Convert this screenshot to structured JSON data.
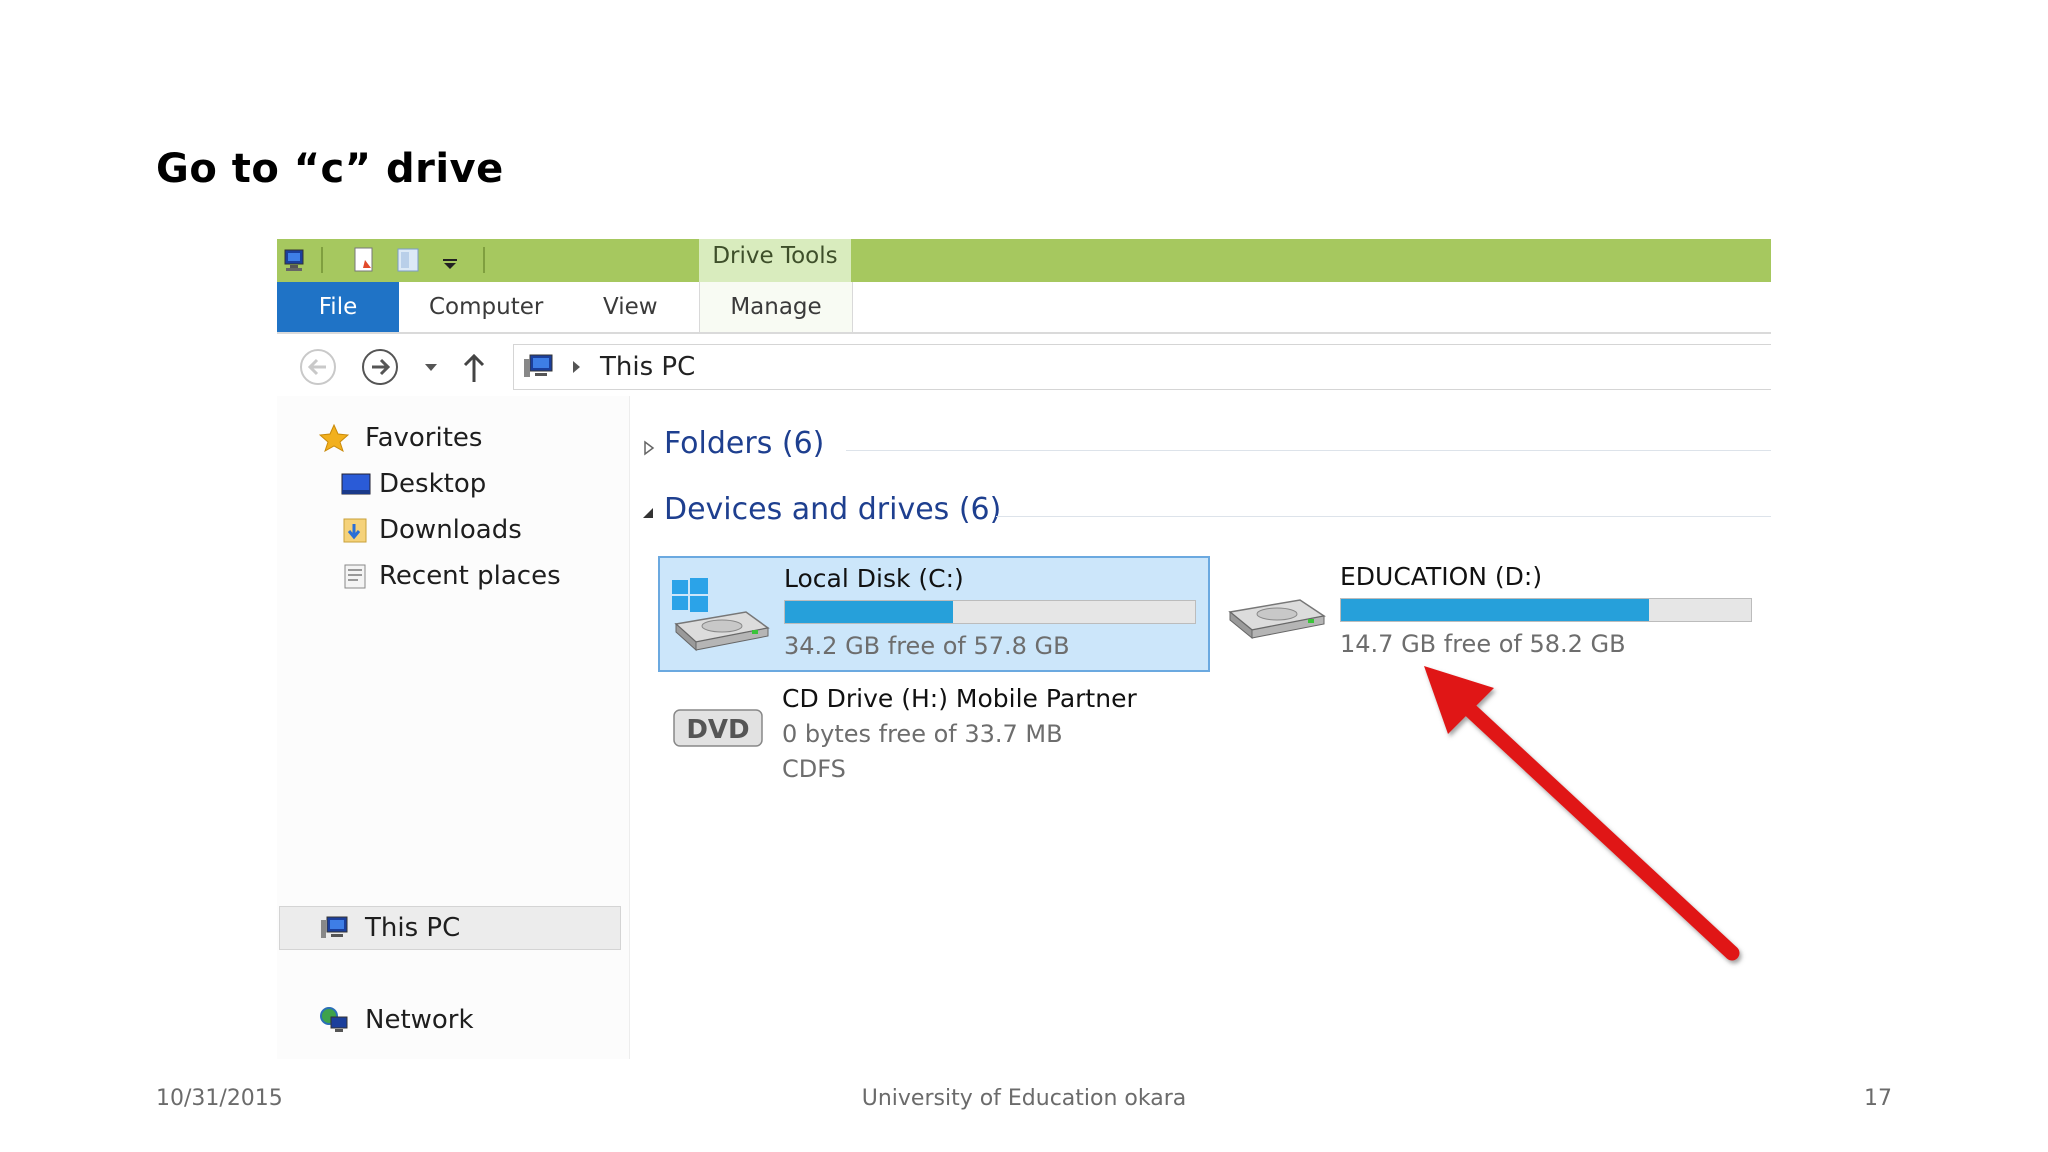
{
  "slide": {
    "title": "Go to “c” drive",
    "footer_date": "10/31/2015",
    "footer_center": "University of Education okara",
    "page_number": "17"
  },
  "ribbon": {
    "context_label": "Drive Tools",
    "tabs": [
      "File",
      "Computer",
      "View",
      "Manage"
    ]
  },
  "address": {
    "location": "This PC"
  },
  "nav": {
    "favorites": "Favorites",
    "desktop": "Desktop",
    "downloads": "Downloads",
    "recent": "Recent places",
    "thispc": "This PC",
    "network": "Network"
  },
  "content": {
    "folders_header": "Folders (6)",
    "devices_header": "Devices and drives (6)",
    "drives": [
      {
        "name": "Local Disk (C:)",
        "free": "34.2 GB free of 57.8 GB",
        "used_fraction": 0.41,
        "selected": true
      },
      {
        "name": "EDUCATION (D:)",
        "free": "14.7 GB free of 58.2 GB",
        "used_fraction": 0.75,
        "selected": false
      }
    ],
    "cd_drive": {
      "name": "CD Drive (H:) Mobile Partner",
      "free": "0 bytes free of 33.7 MB",
      "fs": "CDFS"
    }
  },
  "colors": {
    "title_bar": "#a6c85f",
    "file_tab": "#1f73c6",
    "progress": "#26a0da",
    "selection": "#cce6fa",
    "arrow": "#e01818"
  }
}
